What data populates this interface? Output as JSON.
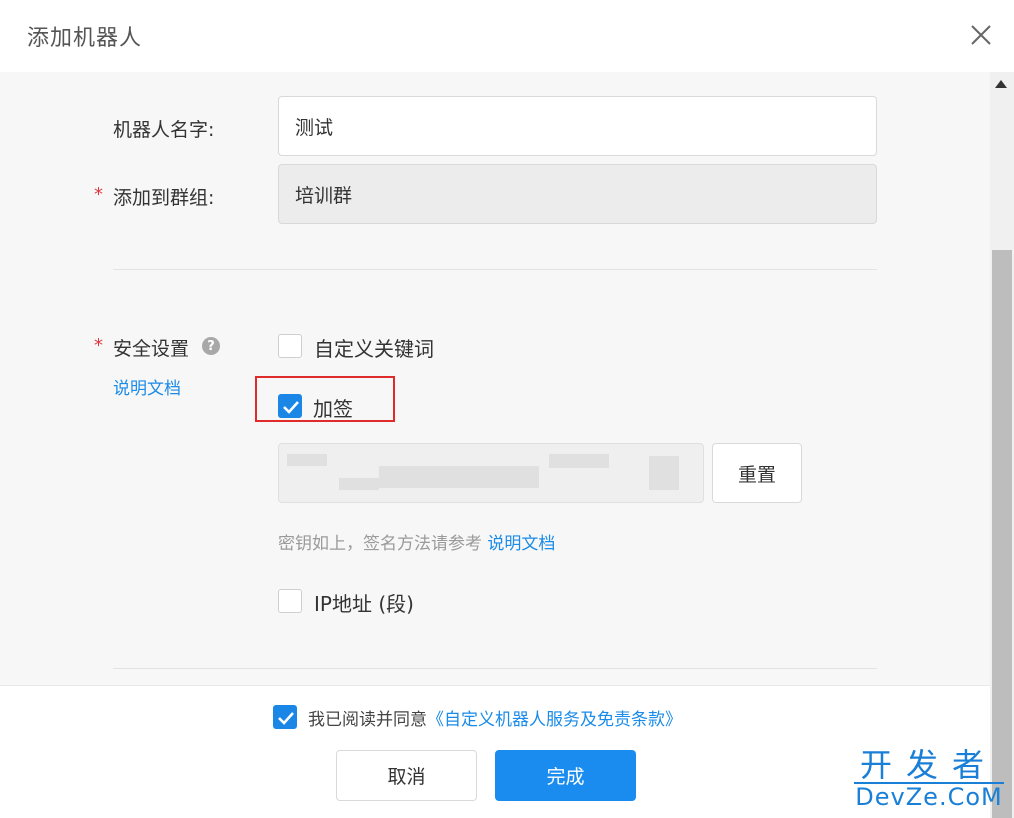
{
  "dialog": {
    "title": "添加机器人",
    "close_icon": "close-icon"
  },
  "form": {
    "robot_name": {
      "label": "机器人名字:",
      "value": "测试"
    },
    "group": {
      "required_mark": "*",
      "label": "添加到群组:",
      "value": "培训群"
    },
    "security": {
      "required_mark": "*",
      "label": "安全设置",
      "help_icon": "?",
      "doc_link": "说明文档",
      "options": [
        {
          "label": "自定义关键词",
          "checked": false
        },
        {
          "label": "加签",
          "checked": true
        },
        {
          "label": "IP地址 (段)",
          "checked": false
        }
      ],
      "reset_label": "重置",
      "hint_text": "密钥如上，签名方法请参考",
      "hint_link": "说明文档"
    }
  },
  "footer": {
    "agree_checked": true,
    "agree_text": "我已阅读并同意",
    "agree_link": "《自定义机器人服务及免责条款》",
    "cancel_label": "取消",
    "done_label": "完成"
  },
  "watermark": {
    "cn": "开发者",
    "en": "DevZe.CoM"
  },
  "colors": {
    "accent": "#1a8cf0",
    "required": "#e0383e",
    "highlight": "#e02b2b"
  }
}
